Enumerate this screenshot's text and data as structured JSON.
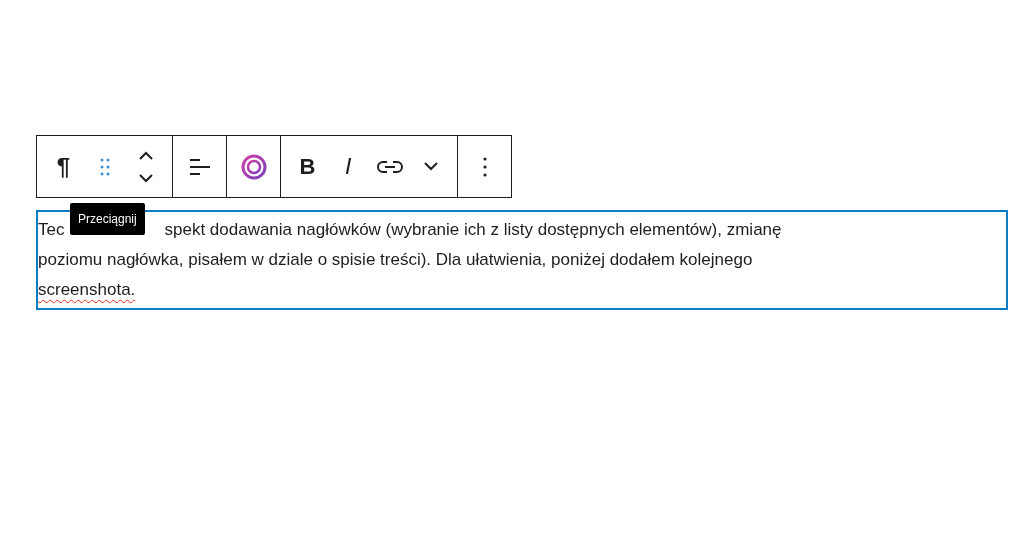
{
  "toolbar": {
    "groups": [
      {
        "buttons": [
          {
            "kind": "paragraph",
            "label": "¶"
          },
          {
            "kind": "drag"
          },
          {
            "kind": "move"
          }
        ]
      },
      {
        "buttons": [
          {
            "kind": "align"
          }
        ]
      },
      {
        "buttons": [
          {
            "kind": "ai"
          }
        ]
      },
      {
        "buttons": [
          {
            "kind": "bold",
            "label": "B"
          },
          {
            "kind": "italic",
            "label": "I"
          },
          {
            "kind": "link"
          },
          {
            "kind": "more-rich"
          }
        ]
      },
      {
        "buttons": [
          {
            "kind": "options"
          }
        ]
      }
    ]
  },
  "tooltip": {
    "text": "Przeciągnij"
  },
  "paragraph": {
    "selected": true,
    "lines": [
      {
        "parts": [
          "Tec",
          "spekt dodawania nagłówków (wybranie ich z listy dostępnych elementów), zmianę"
        ]
      },
      {
        "parts": [
          "poziomu nagłówka, pisałem w dziale o spisie treści). Dla ułatwienia, poniżej dodałem kolejnego"
        ]
      },
      {
        "parts": [
          "screenshota."
        ],
        "misspelled": true
      }
    ]
  }
}
